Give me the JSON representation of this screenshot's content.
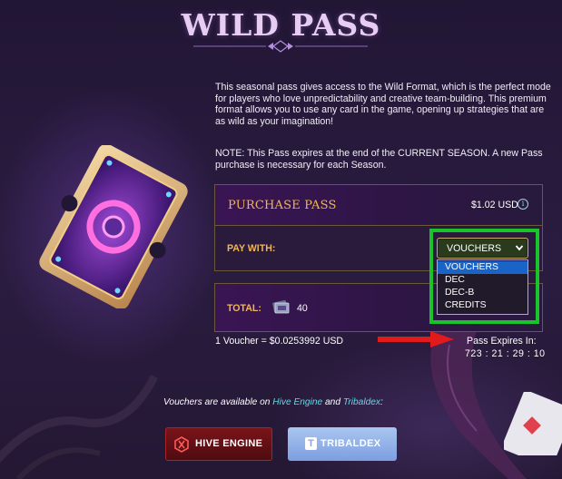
{
  "page": {
    "title": "WILD PASS"
  },
  "description": "This seasonal pass gives access to the Wild Format, which is the perfect mode for players who love unpredictability and creative team-building. This premium format allows you to use any card in the game, opening up strategies that are as wild as your imagination!",
  "note": "NOTE: This Pass expires at the end of the CURRENT SEASON. A new Pass purchase is necessary for each Season.",
  "purchase": {
    "title": "PURCHASE PASS",
    "price": "$1.02 USD",
    "info_icon": "i"
  },
  "pay_with": {
    "label": "PAY WITH:",
    "selected": "VOUCHERS",
    "options": [
      "VOUCHERS",
      "DEC",
      "DEC-B",
      "CREDITS"
    ]
  },
  "total": {
    "label": "TOTAL:",
    "value": "40"
  },
  "rate": "1 Voucher = $0.0253992 USD",
  "expires": {
    "label": "Pass Expires In:",
    "time": "723 : 21 : 29 : 10"
  },
  "vouchers_note": {
    "prefix": "Vouchers are available on ",
    "link1": "Hive Engine",
    "middle": " and ",
    "link2": "Tribaldex",
    "suffix": ":"
  },
  "buttons": {
    "hive_engine": "HIVE ENGINE",
    "tribaldex": "TRIBALDEX",
    "tribaldex_logo": "T"
  },
  "colors": {
    "accent_gold": "#f0b55a",
    "highlight_green": "#19c32a",
    "link_cyan": "#63d7e5",
    "annotation_red": "#e11b1b",
    "hive_red": "#7a1419",
    "tribaldex_blue": "#8aa6e4"
  },
  "icons": {
    "ticket": "wild-pass-ticket-icon",
    "info": "info-icon",
    "voucher": "voucher-icon",
    "chevron": "chevron-down-icon",
    "hive_logo": "hive-logo-icon",
    "tribaldex_logo": "tribaldex-logo-icon",
    "arrow": "red-arrow-annotation"
  }
}
